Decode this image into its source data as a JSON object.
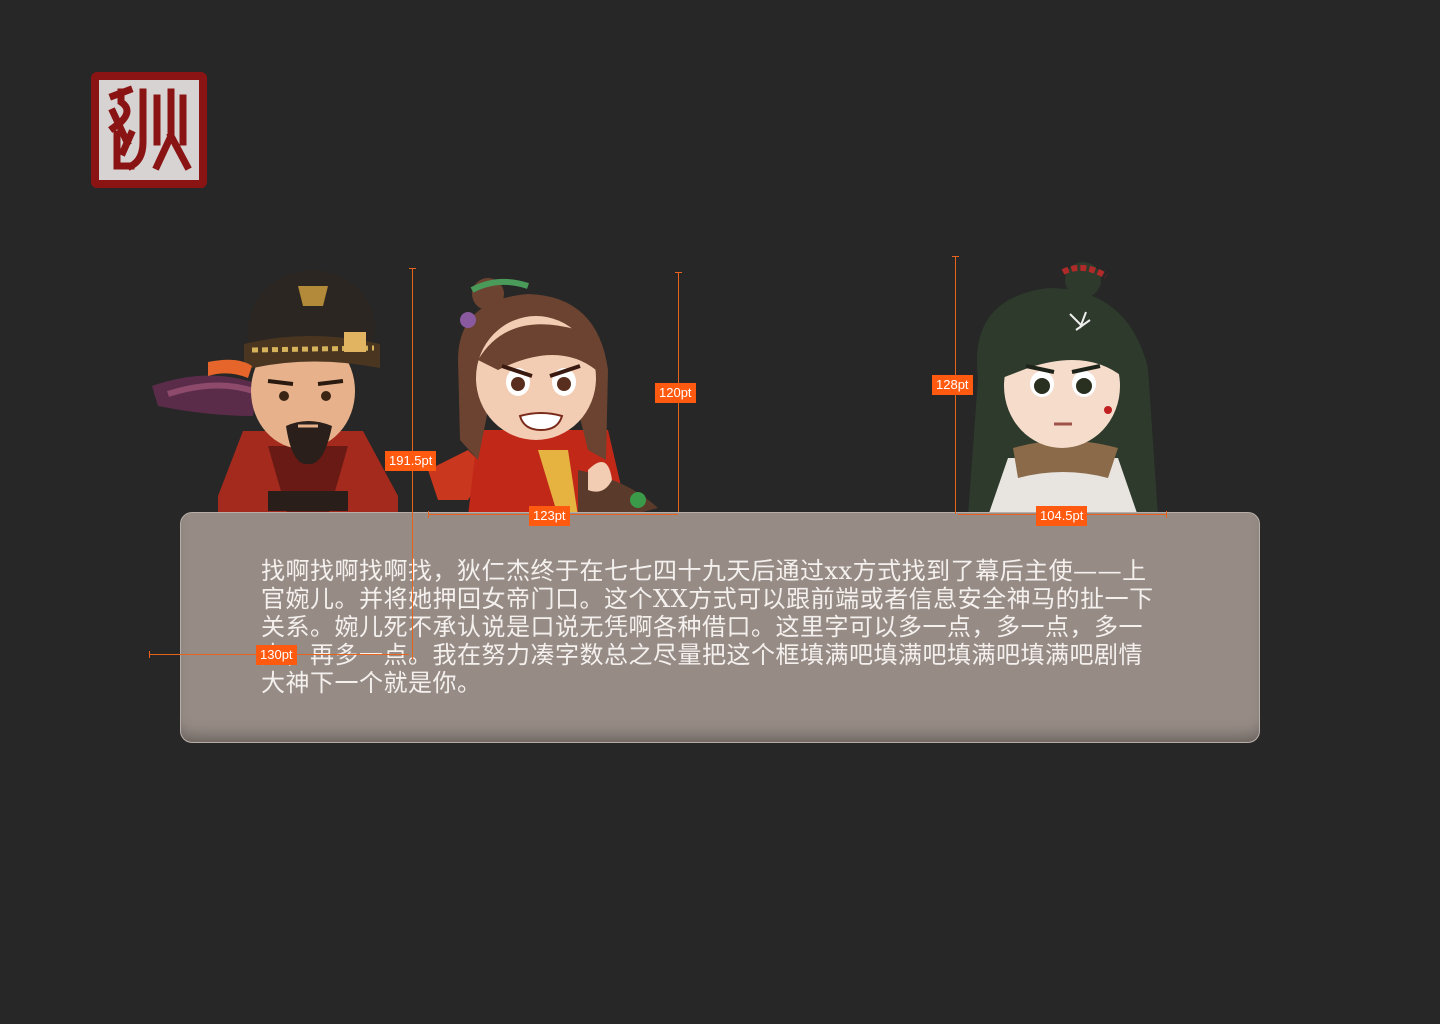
{
  "seal": {
    "icon": "seal-stamp-icon",
    "color": "#8a1414",
    "glyph": "狄"
  },
  "characters": [
    {
      "name": "狄仁杰",
      "icon": "official-character-portrait"
    },
    {
      "name": "上官婉儿",
      "icon": "angry-girl-character-portrait"
    },
    {
      "name": "",
      "icon": "green-hair-girl-character-portrait"
    }
  ],
  "dialog": {
    "text": "找啊找啊找啊找，狄仁杰终于在七七四十九天后通过xx方式找到了幕后主使——上官婉儿。并将她押回女帝门口。这个XX方式可以跟前端或者信息安全神马的扯一下关系。婉儿死不承认说是口说无凭啊各种借口。这里字可以多一点，多一点，多一点，再多一点。我在努力凑字数总之尽量把这个框填满吧填满吧填满吧填满吧剧情大神下一个就是你。",
    "background": "#968b85"
  },
  "dimensions": {
    "height_di": "191.5pt",
    "width_wan": "123pt",
    "height_wan": "120pt",
    "height_girl": "128pt",
    "width_girl": "104.5pt",
    "indent": "130pt",
    "accent": "#ff5a10"
  }
}
